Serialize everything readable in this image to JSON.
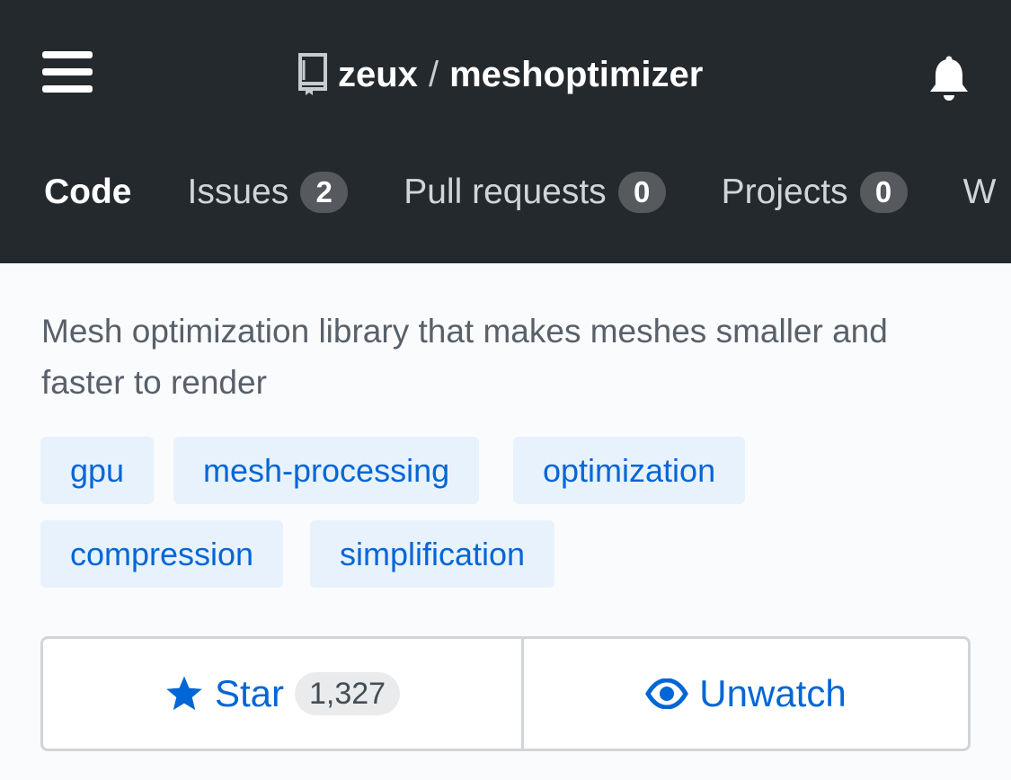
{
  "header": {
    "owner": "zeux",
    "separator": "/",
    "repo": "meshoptimizer",
    "icons": {
      "menu": "hamburger-icon",
      "repo": "repo-book-icon",
      "notifications": "bell-icon"
    }
  },
  "tabs": [
    {
      "label": "Code",
      "active": true
    },
    {
      "label": "Issues",
      "count": "2"
    },
    {
      "label": "Pull requests",
      "count": "0"
    },
    {
      "label": "Projects",
      "count": "0"
    },
    {
      "label": "W",
      "clipped": true
    }
  ],
  "description": "Mesh optimization library that makes meshes smaller and faster to render",
  "topics": [
    "gpu",
    "mesh-processing",
    "optimization",
    "compression",
    "simplification"
  ],
  "actions": {
    "star": {
      "label": "Star",
      "count": "1,327",
      "icon": "star-icon"
    },
    "watch": {
      "label": "Unwatch",
      "icon": "eye-icon"
    }
  },
  "colors": {
    "header_bg": "#24292e",
    "accent": "#0366d6",
    "topic_bg": "#e8f2fc",
    "page_bg": "#fafbfc"
  }
}
